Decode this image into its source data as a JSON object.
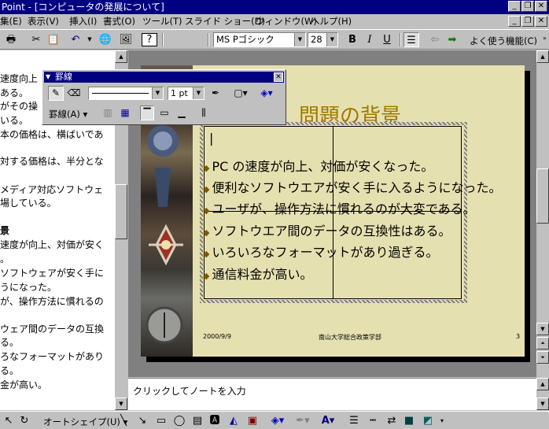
{
  "window": {
    "title": "Point - [コンピュータの発展について]"
  },
  "menu": [
    "集(E)",
    "表示(V)",
    "挿入(I)",
    "書式(O)",
    "ツール(T)",
    "スライド ショー(D)",
    "ウィンドウ(W)",
    "ヘルプ(H)"
  ],
  "toolbar": {
    "font": "MS Pゴシック",
    "size": "28",
    "bold": "B",
    "italic": "I",
    "underline": "U",
    "common_tasks": "よく使う機能(C)"
  },
  "borders_toolbar": {
    "title": "罫線",
    "line_weight": "1 pt",
    "borders_label": "罫線(A)"
  },
  "outline": {
    "lines": [
      "速度向上",
      "ある。",
      "がその操",
      "いる。",
      "本の価格は、横ばいであ",
      "",
      "対する価格は、半分とな",
      "",
      "メディア対応ソフトウェ",
      "場している。",
      "",
      "景",
      "速度が向上、対価が安く",
      "。",
      "ソフトウェアが安く手に",
      "うになった。",
      "が、操作方法に慣れるの",
      "ウェア間のデータの互換",
      "る。",
      "ろなフォーマットがあり",
      "る。",
      "金が高い。"
    ]
  },
  "slide": {
    "title": "問題の背景",
    "bullets": [
      "PC の速度が向上、対価が安くなった。",
      "便利なソフトウエアが安く手に入るようになった。",
      "ユーザが、操作方法に慣れるのが大変である。",
      "ソフトウエア間のデータの互換性はある。",
      "いろいろなフォーマットがあり過ぎる。",
      "通信料金が高い。"
    ],
    "footer_date": "2000/9/9",
    "footer_org": "南山大学総合政策学部",
    "footer_page": "3"
  },
  "notes": {
    "placeholder": "クリックしてノートを入力"
  },
  "drawbar": {
    "autoshape": "オートシェイプ(U)"
  }
}
